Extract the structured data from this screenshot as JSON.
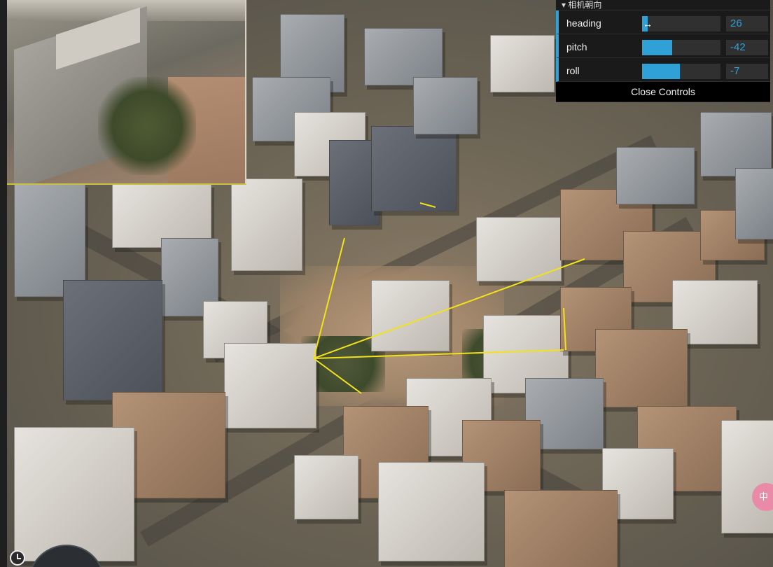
{
  "gui": {
    "folder_title": "相机朝向",
    "controls": [
      {
        "label": "heading",
        "value": "26",
        "fraction": 0.07
      },
      {
        "label": "pitch",
        "value": "-42",
        "fraction": 0.38
      },
      {
        "label": "roll",
        "value": "-7",
        "fraction": 0.48
      }
    ],
    "close_label": "Close Controls",
    "accent_color": "#2fa1d6",
    "background_color": "#1a1a1a"
  },
  "overlay": {
    "frustum_color": "#f2e21a",
    "badge_text": "中"
  },
  "icons": {
    "clock": "clock-icon",
    "compass": "compass-icon",
    "cursor": "resize-cursor-icon"
  }
}
